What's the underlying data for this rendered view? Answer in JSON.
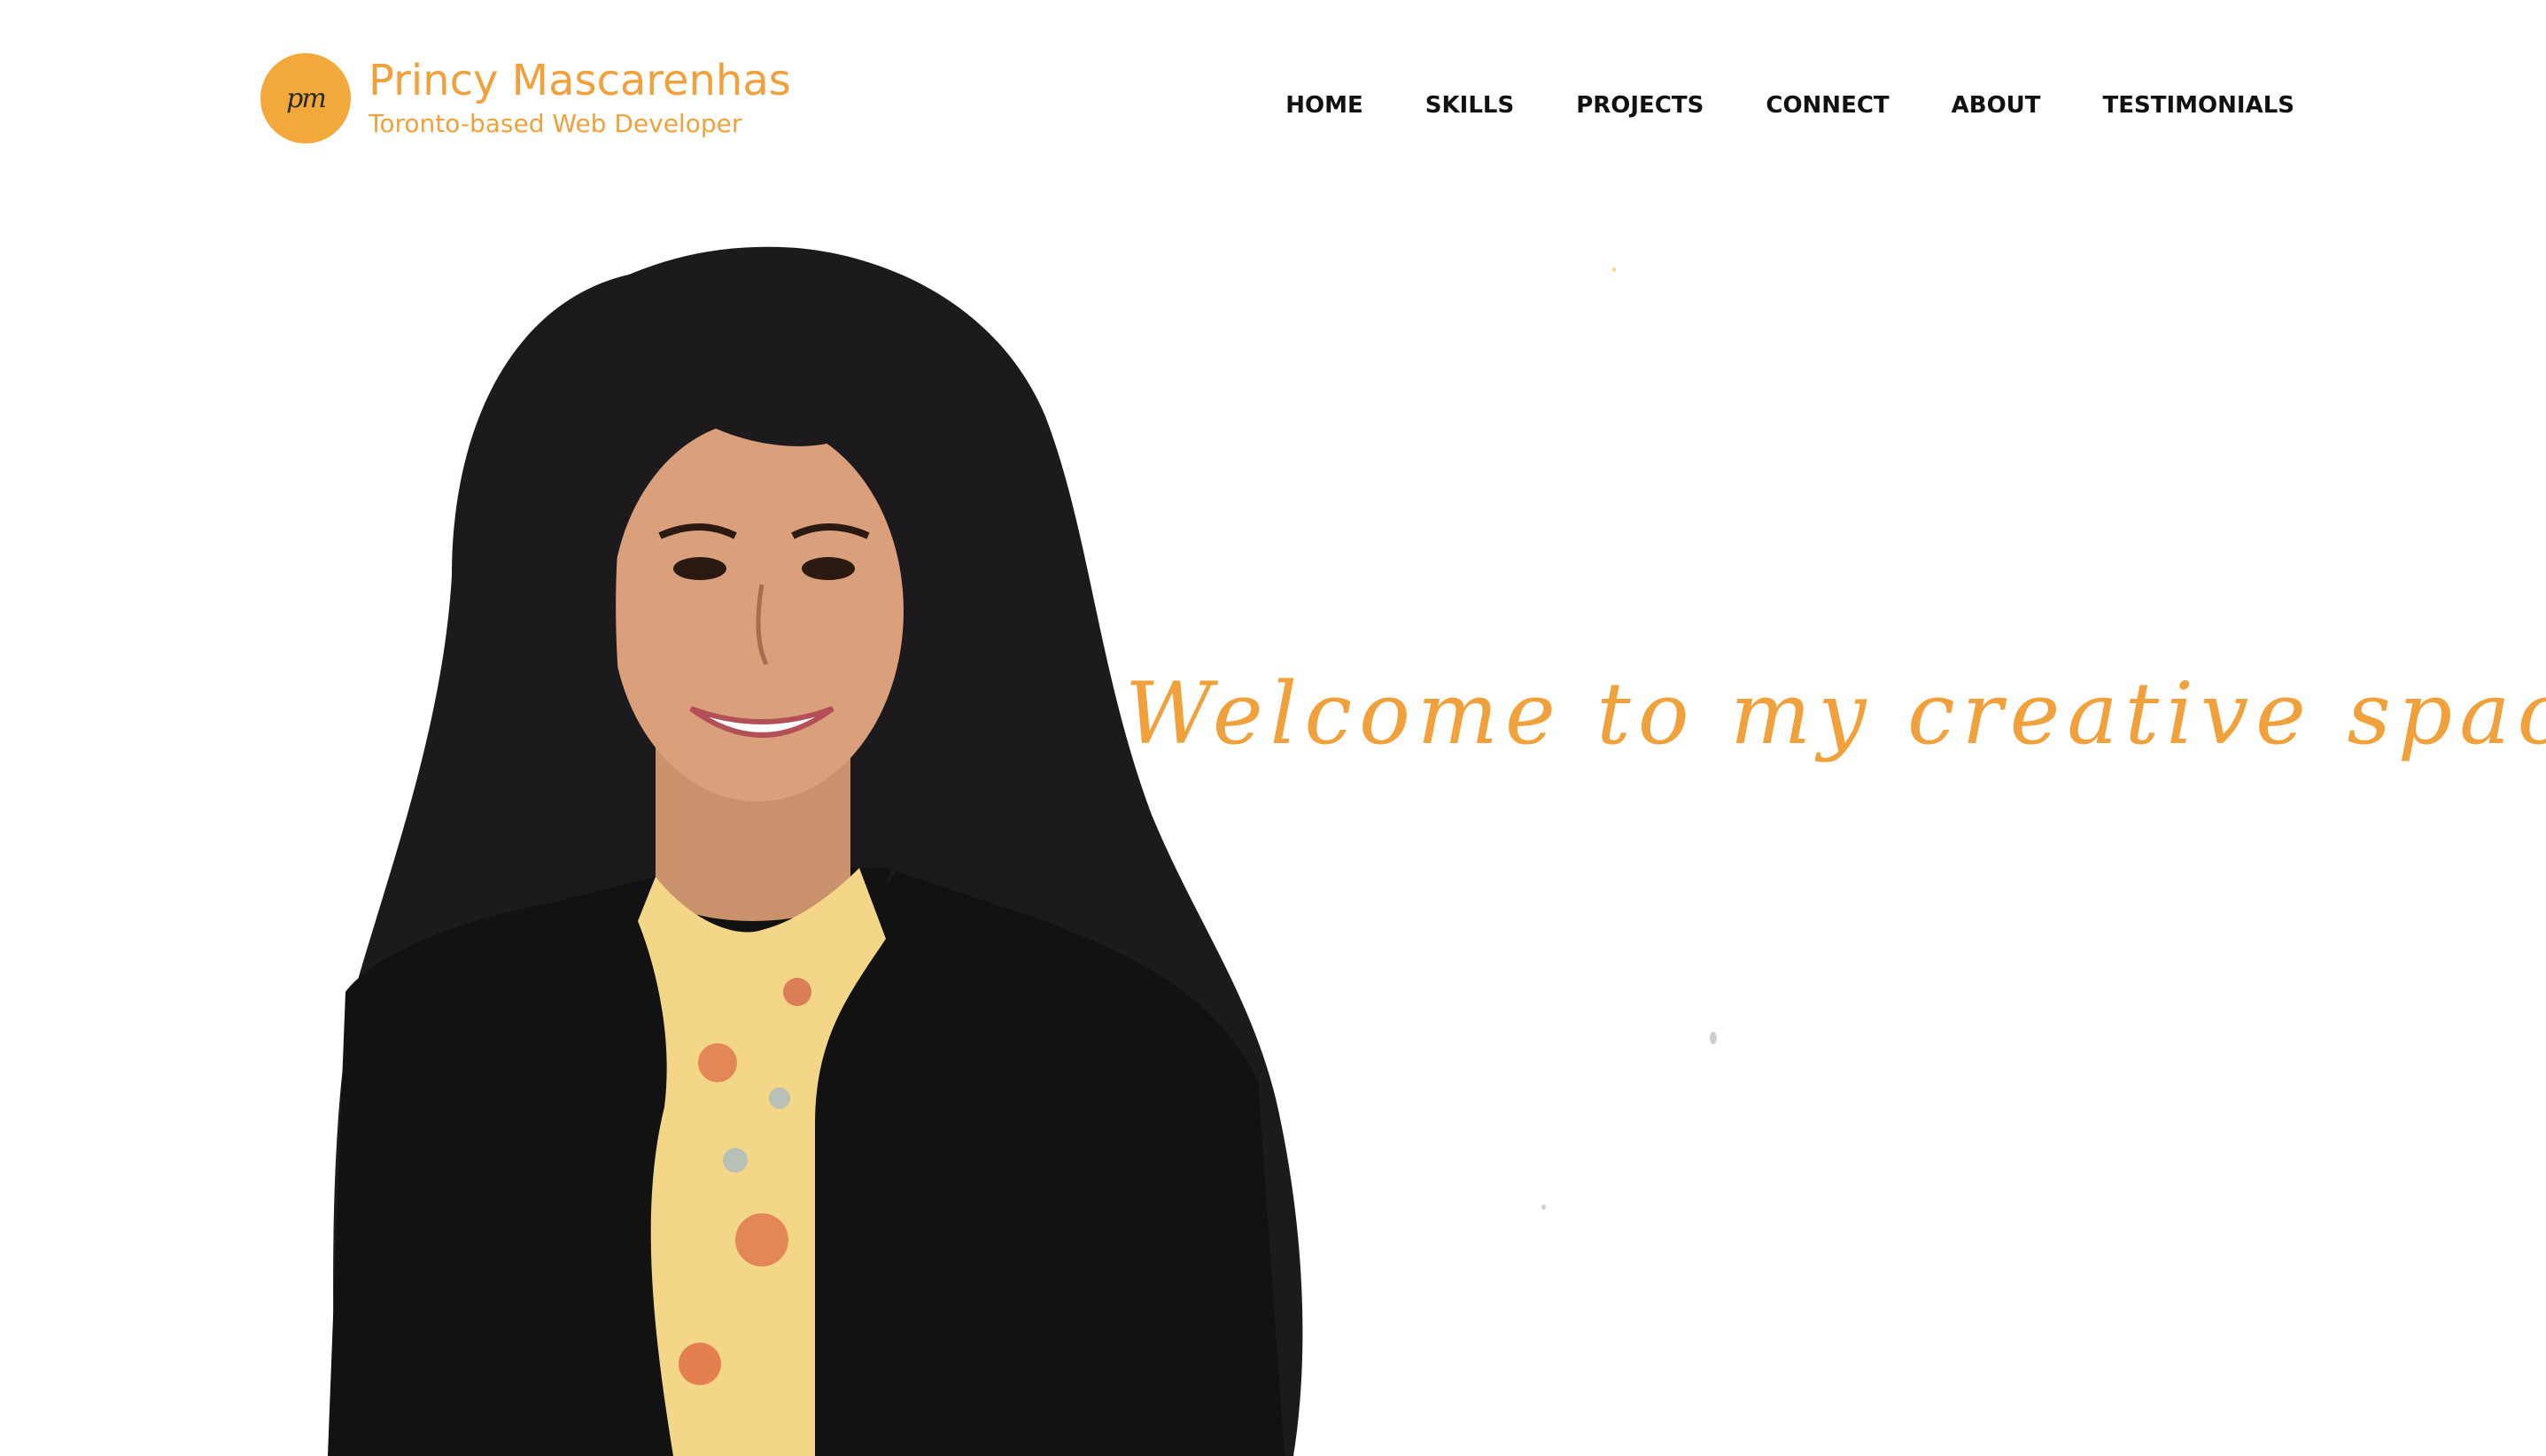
{
  "brand": {
    "logo_initials": "pm",
    "name": "Princy Mascarenhas",
    "tagline": "Toronto-based Web Developer"
  },
  "nav": {
    "items": [
      {
        "label": "HOME"
      },
      {
        "label": "SKILLS"
      },
      {
        "label": "PROJECTS"
      },
      {
        "label": "CONNECT"
      },
      {
        "label": "ABOUT"
      },
      {
        "label": "TESTIMONIALS"
      }
    ]
  },
  "hero": {
    "welcome_text": "Welcome to my creative space!"
  },
  "colors": {
    "accent": "#f0a13c",
    "logo_bg": "#f2a83b",
    "nav_text": "#111111",
    "background": "#ffffff"
  }
}
